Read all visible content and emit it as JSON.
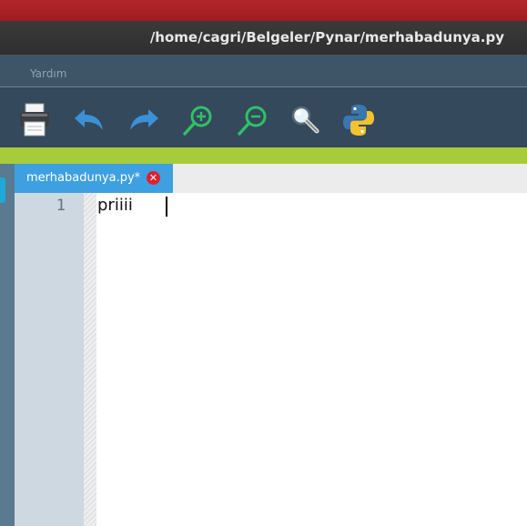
{
  "window": {
    "title": "/home/cagri/Belgeler/Pynar/merhabadunya.py"
  },
  "menubar": {
    "items": [
      {
        "label": "Yardım"
      }
    ]
  },
  "toolbar": {
    "buttons": [
      "print",
      "undo",
      "redo",
      "zoom-in",
      "zoom-out",
      "find",
      "python-run"
    ]
  },
  "tabs": [
    {
      "label": "merhabadunya.py*",
      "modified": true,
      "active": true
    }
  ],
  "editor": {
    "lines": [
      {
        "number": "1",
        "text": "priiii"
      }
    ]
  },
  "colors": {
    "accent": "#3ea0e0",
    "green_bar": "#a6cc3b",
    "titlebar_red": "#b3262a",
    "toolbar_bg": "#34495b",
    "close_badge": "#e02030"
  }
}
